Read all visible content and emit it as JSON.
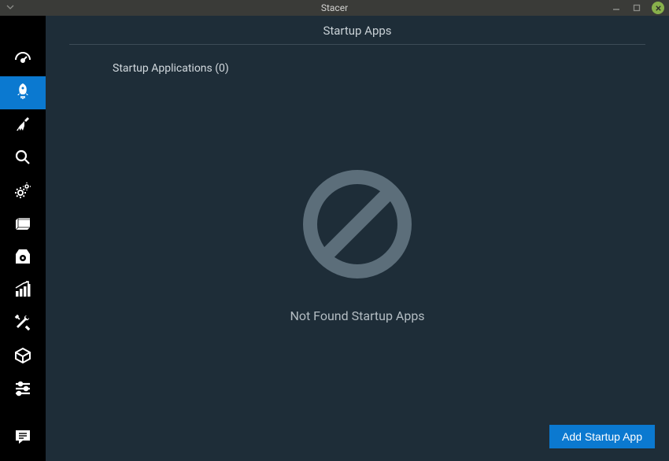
{
  "window": {
    "title": "Stacer"
  },
  "page": {
    "header": "Startup Apps",
    "section_title": "Startup Applications (0)",
    "empty_message": "Not Found Startup Apps",
    "add_button": "Add Startup App"
  },
  "sidebar": {
    "items": [
      {
        "name": "dashboard"
      },
      {
        "name": "startup-apps"
      },
      {
        "name": "system-cleaner"
      },
      {
        "name": "search"
      },
      {
        "name": "services"
      },
      {
        "name": "processes"
      },
      {
        "name": "uninstaller"
      },
      {
        "name": "resources"
      },
      {
        "name": "helpers"
      },
      {
        "name": "apt-repository"
      },
      {
        "name": "settings"
      }
    ]
  }
}
